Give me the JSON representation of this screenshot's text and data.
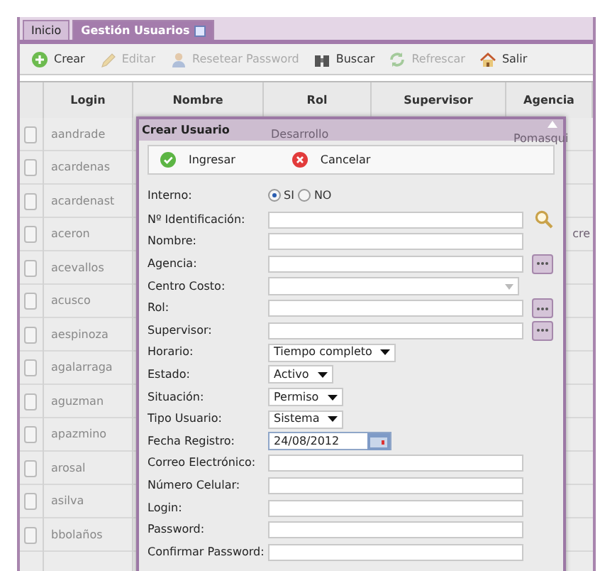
{
  "tabs": [
    {
      "label": "Inicio",
      "selected": false,
      "closable": false
    },
    {
      "label": "Gestión Usuarios",
      "selected": true,
      "closable": true
    }
  ],
  "toolbar": [
    {
      "label": "Crear",
      "disabled": false
    },
    {
      "label": "Editar",
      "disabled": true
    },
    {
      "label": "Resetear Password",
      "disabled": true
    },
    {
      "label": "Buscar",
      "disabled": false
    },
    {
      "label": "Refrescar",
      "disabled": true
    },
    {
      "label": "Salir",
      "disabled": false
    }
  ],
  "grid": {
    "columns": [
      "Login",
      "Nombre",
      "Rol",
      "Supervisor",
      "Agencia"
    ],
    "rows": [
      {
        "login": "aandrade",
        "rol": "Desarrollo",
        "agencia": "Pomasqui",
        "checked": false
      },
      {
        "login": "acardenas",
        "checked": false
      },
      {
        "login": "acardenast",
        "checked": false
      },
      {
        "login": "aceron",
        "agencia": "cre",
        "checked": false
      },
      {
        "login": "acevallos",
        "checked": false
      },
      {
        "login": "acusco",
        "checked": false
      },
      {
        "login": "aespinoza",
        "checked": false
      },
      {
        "login": "agalarraga",
        "checked": false
      },
      {
        "login": "aguzman",
        "checked": false
      },
      {
        "login": "apazmino",
        "checked": false
      },
      {
        "login": "arosal",
        "checked": false
      },
      {
        "login": "asilva",
        "checked": false
      },
      {
        "login": "bbolaños",
        "checked": false
      }
    ]
  },
  "dialog": {
    "title": "Crear Usuario",
    "buttons": [
      {
        "label": "Ingresar",
        "kind": "ok"
      },
      {
        "label": "Cancelar",
        "kind": "cancel"
      }
    ],
    "fields": [
      {
        "label": "Interno:",
        "kind": "radio",
        "options": [
          {
            "label": "SI",
            "selected": true
          },
          {
            "label": "NO",
            "selected": false
          }
        ]
      },
      {
        "label": "Nº Identificación:",
        "kind": "search"
      },
      {
        "label": "Nombre:",
        "kind": "text"
      },
      {
        "label": "Agencia:",
        "kind": "picker"
      },
      {
        "label": "Centro Costo:",
        "kind": "combo"
      },
      {
        "label": "Rol:",
        "kind": "picker"
      },
      {
        "label": "Supervisor:",
        "kind": "picker"
      },
      {
        "label": "Horario:",
        "kind": "select",
        "value": "Tiempo completo"
      },
      {
        "label": "Estado:",
        "kind": "select",
        "value": "Activo"
      },
      {
        "label": "Situación:",
        "kind": "select",
        "value": "Permiso"
      },
      {
        "label": "Tipo Usuario:",
        "kind": "select",
        "value": "Sistema"
      },
      {
        "label": "Fecha Registro:",
        "kind": "date",
        "value": "24/08/2012"
      },
      {
        "label": "Correo Electrónico:",
        "kind": "text"
      },
      {
        "label": "Número Celular:",
        "kind": "text"
      },
      {
        "label": "Login:",
        "kind": "text"
      },
      {
        "label": "Password:",
        "kind": "text"
      },
      {
        "label": "Confirmar Password:",
        "kind": "text"
      }
    ]
  }
}
